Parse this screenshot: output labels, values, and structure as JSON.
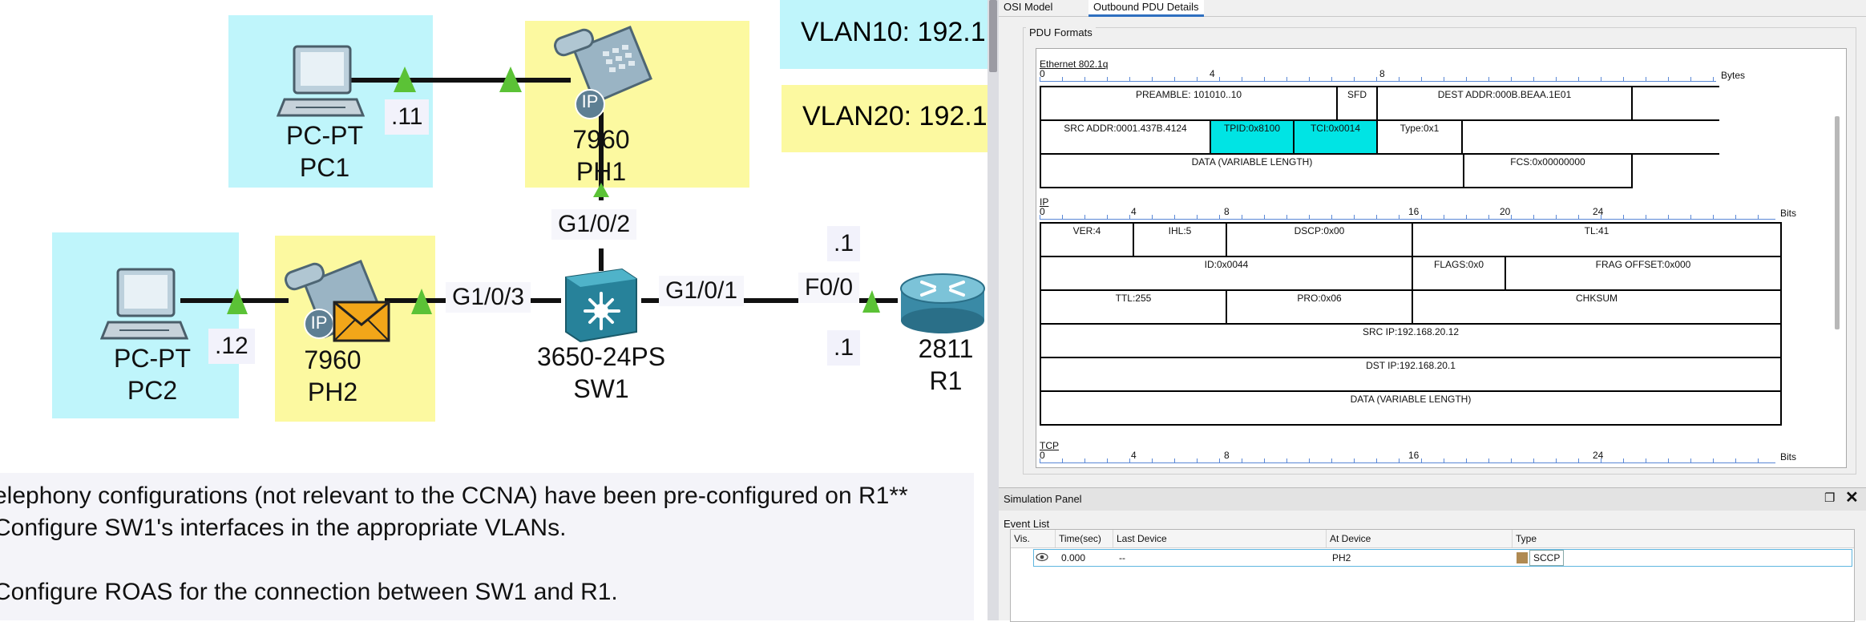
{
  "topology": {
    "vlan_notes": [
      "VLAN10: 192.1",
      "VLAN20: 192.1"
    ],
    "devices": {
      "pc1": {
        "model": "PC-PT",
        "name": "PC1"
      },
      "pc2": {
        "model": "PC-PT",
        "name": "PC2"
      },
      "ph1": {
        "model": "7960",
        "name": "PH1"
      },
      "ph2": {
        "model": "7960",
        "name": "PH2"
      },
      "sw1": {
        "model": "3650-24PS",
        "name": "SW1"
      },
      "r1": {
        "model": "2811",
        "name": "R1"
      }
    },
    "ip_labels": {
      "pc1": ".11",
      "pc2": ".12",
      "r1_top": ".1",
      "r1_bottom": ".1"
    },
    "ports": {
      "sw_ph1": "G1/0/2",
      "sw_ph2": "G1/0/3",
      "sw_r1": "G1/0/1",
      "r1": "F0/0"
    },
    "phone_badge": "IP",
    "link_color": "#111111",
    "link_light_color": "#5bc236",
    "pc_zone_color": "#bff5fb",
    "phone_zone_color": "#fcf9a0"
  },
  "instructions": [
    "elephony configurations (not relevant to the CCNA) have been pre-configured on R1**",
    "Configure SW1's interfaces in the appropriate VLANs.",
    "Configure ROAS for the connection between SW1 and R1."
  ],
  "panel": {
    "tabs": [
      "OSI Model",
      "Outbound PDU Details"
    ],
    "active_tab": "Outbound PDU Details",
    "group_title": "PDU Formats",
    "ethernet": {
      "title": "Ethernet 802.1q",
      "ruler": [
        "0",
        "4",
        "8"
      ],
      "unit": "Bytes",
      "fields": {
        "preamble": "PREAMBLE: 101010..10",
        "sfd": "SFD",
        "dest": "DEST ADDR:000B.BEAA.1E01",
        "src": "SRC ADDR:0001.437B.4124",
        "tpid": "TPID:0x8100",
        "tci": "TCI:0x0014",
        "type": "Type:0x1",
        "data": "DATA (VARIABLE LENGTH)",
        "fcs": "FCS:0x00000000"
      }
    },
    "ip": {
      "title": "IP",
      "ruler": [
        "0",
        "4",
        "8",
        "16",
        "20",
        "24"
      ],
      "unit": "Bits",
      "fields": {
        "ver": "VER:4",
        "ihl": "IHL:5",
        "dscp": "DSCP:0x00",
        "tl": "TL:41",
        "id": "ID:0x0044",
        "flags": "FLAGS:0x0",
        "frag": "FRAG OFFSET:0x000",
        "ttl": "TTL:255",
        "pro": "PRO:0x06",
        "chksum": "CHKSUM",
        "src": "SRC IP:192.168.20.12",
        "dst": "DST IP:192.168.20.1",
        "data": "DATA (VARIABLE LENGTH)"
      }
    },
    "tcp": {
      "title": "TCP",
      "ruler": [
        "0",
        "4",
        "8",
        "16",
        "24"
      ],
      "unit": "Bits"
    },
    "highlight_color": "#00e4e4"
  },
  "simulation": {
    "title": "Simulation Panel",
    "event_list_label": "Event List",
    "columns": [
      "Vis.",
      "Time(sec)",
      "Last Device",
      "At Device",
      "Type"
    ],
    "events": [
      {
        "time": "0.000",
        "last_device": "--",
        "at_device": "PH2",
        "type": "SCCP",
        "type_color": "#b08a52"
      }
    ]
  }
}
